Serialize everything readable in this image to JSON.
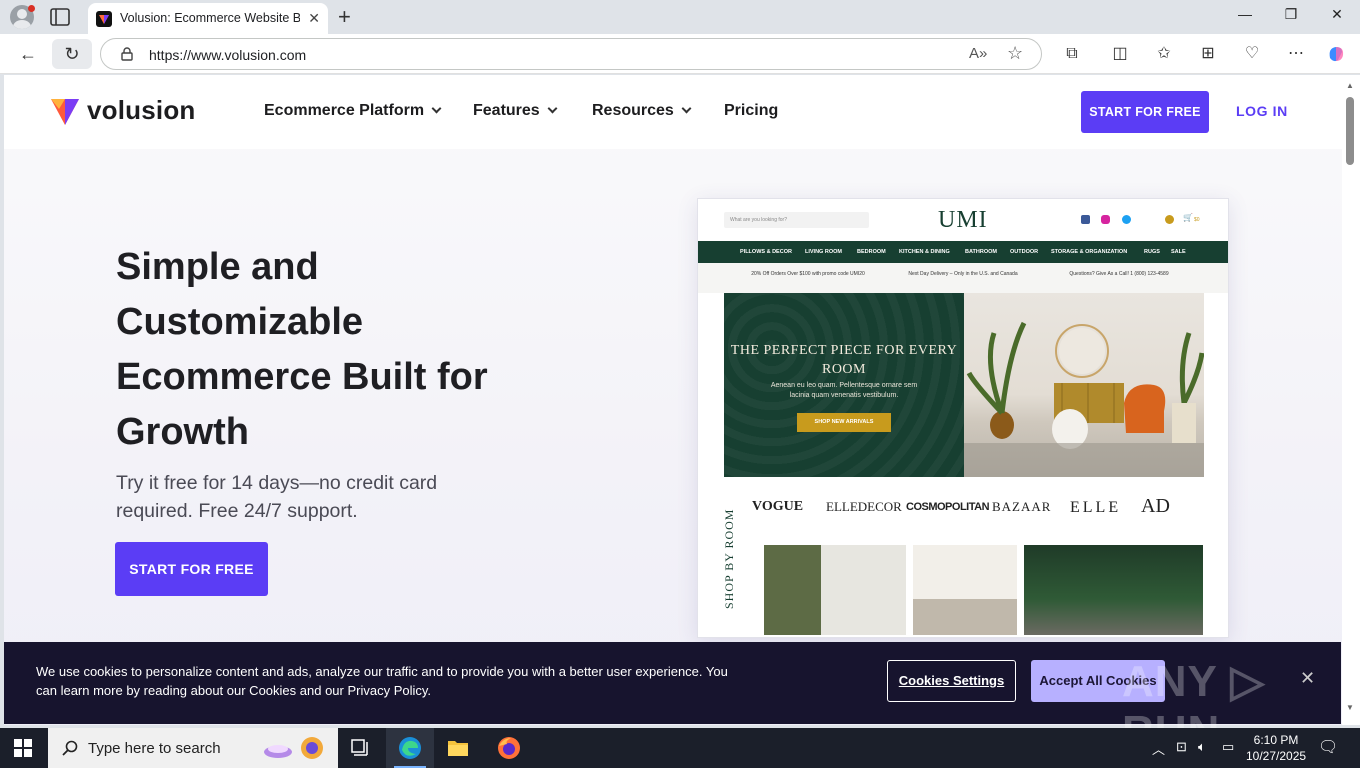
{
  "browser": {
    "tab_title": "Volusion: Ecommerce Website Bui",
    "url": "https://www.volusion.com",
    "read_aloud_glyph": "A»"
  },
  "header": {
    "logo_text": "volusion",
    "nav": [
      {
        "label": "Ecommerce Platform",
        "has_dropdown": true
      },
      {
        "label": "Features",
        "has_dropdown": true
      },
      {
        "label": "Resources",
        "has_dropdown": true
      },
      {
        "label": "Pricing",
        "has_dropdown": false
      }
    ],
    "start_label": "START FOR FREE",
    "login_label": "LOG IN"
  },
  "hero": {
    "title": "Simple and Customizable Ecommerce Built for Growth",
    "subtitle": "Try it free for 14 days—no credit card required. Free 24/7 support.",
    "cta_label": "START FOR FREE"
  },
  "mockup": {
    "search_placeholder": "What are you looking for?",
    "logo": "UMI",
    "nav": [
      "PILLOWS & DECOR",
      "LIVING ROOM",
      "BEDROOM",
      "KITCHEN & DINING",
      "BATHROOM",
      "OUTDOOR",
      "STORAGE & ORGANIZATION",
      "RUGS",
      "SALE"
    ],
    "promos": [
      "20% Off Orders Over $100 with promo code UMI20",
      "Next Day Delivery – Only in the U.S. and Canada",
      "Questions? Give As a Call! 1 (800) 123-4589"
    ],
    "banner_title": "THE PERFECT PIECE FOR EVERY ROOM",
    "banner_text": "Aenean eu leo quam. Pellentesque ornare sem lacinia quam venenatis vestibulum.",
    "banner_button": "SHOP NEW ARRIVALS",
    "press": [
      "VOGUE",
      "ELLEDECOR",
      "COSMOPOLITAN",
      "BAZAAR",
      "ELLE",
      "AD"
    ],
    "shop_by_room": "SHOP BY ROOM",
    "cart_count": "$0"
  },
  "cookie": {
    "text": "We use cookies to personalize content and ads, analyze our traffic and to provide you with a better user experience. You can learn more by reading about our Cookies and our Privacy Policy.",
    "settings_label": "Cookies Settings",
    "accept_label": "Accept All Cookies",
    "watermark": "ANY ▷ RUN"
  },
  "taskbar": {
    "search_placeholder": "Type here to search",
    "time": "6:10 PM",
    "date": "10/27/2025"
  },
  "colors": {
    "brand": "#5b3df5",
    "cookie_bg": "#17142e",
    "accept_bg": "#b7b0ff",
    "mock_green": "#173f31"
  }
}
